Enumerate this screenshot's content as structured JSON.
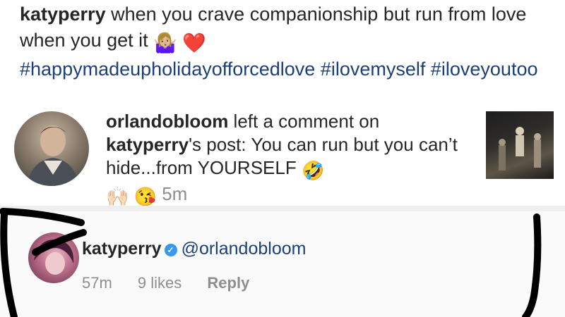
{
  "caption": {
    "username": "katyperry",
    "text": " when you crave companionship but run from love when you get it ",
    "hashtags": "#happymadeupholidayofforcedlove #ilovemyself #iloveyoutoo",
    "emoji_1": "🤷🏼‍♀️",
    "emoji_2": "❤️"
  },
  "notification": {
    "username": "orlandobloom",
    "text_1": " left a comment on ",
    "target_user": "katyperry",
    "text_2": "'s post: You can run but you can’t hide...from YOURSELF ",
    "emoji_1": "🤣",
    "emoji_2": "🙌🏻",
    "emoji_3": "😘",
    "time": "5m"
  },
  "reply": {
    "username": "katyperry",
    "verified_mark": "✓",
    "mention": "@orlandobloom",
    "time": "57m",
    "likes": "9 likes",
    "reply_label": "Reply"
  },
  "colors": {
    "hashtag": "#1b3f7a",
    "muted": "#8e8e8e",
    "verified": "#3897f0",
    "ink": "#000000"
  },
  "icons": {
    "verified": "verified-badge-icon"
  }
}
